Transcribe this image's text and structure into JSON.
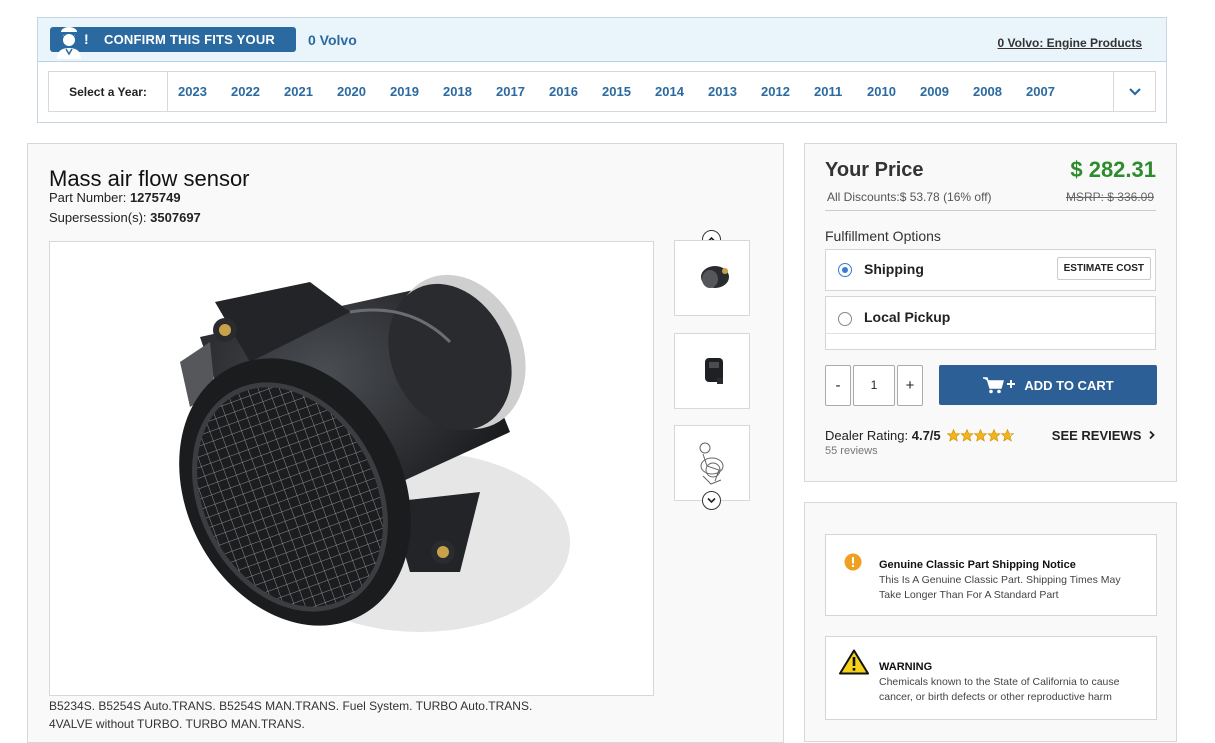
{
  "fitment": {
    "confirm_label": "CONFIRM THIS FITS YOUR",
    "vehicle": "0 Volvo",
    "engine_link": "0 Volvo: Engine Products",
    "year_label": "Select a Year:",
    "years": [
      "2023",
      "2022",
      "2021",
      "2020",
      "2019",
      "2018",
      "2017",
      "2016",
      "2015",
      "2014",
      "2013",
      "2012",
      "2011",
      "2010",
      "2009",
      "2008",
      "2007"
    ]
  },
  "product": {
    "title": "Mass air flow sensor",
    "part_number_label": "Part Number:",
    "part_number": "1275749",
    "supersession_label": "Supersession(s):",
    "supersession": "3507697",
    "description_line1": "B5234S. B5254S Auto.TRANS. B5254S MAN.TRANS. Fuel System. TURBO Auto.TRANS.",
    "description_line2": "4VALVE without TURBO. TURBO MAN.TRANS."
  },
  "pricing": {
    "your_price_label": "Your Price",
    "price": "$ 282.31",
    "discounts": "All Discounts:$ 53.78 (16% off)",
    "msrp": "MSRP: $ 336.09",
    "fulfillment_label": "Fulfillment Options",
    "shipping_label": "Shipping",
    "estimate_label": "ESTIMATE COST",
    "pickup_label": "Local Pickup",
    "qty_minus": "-",
    "qty_value": "1",
    "qty_plus": "+",
    "add_to_cart": "ADD TO CART",
    "dealer_rating_label": "Dealer Rating:",
    "dealer_rating": "4.7/5",
    "rating_value": 4.7,
    "reviews_count": "55 reviews",
    "see_reviews": "SEE REVIEWS"
  },
  "notices": {
    "shipping_title": "Genuine Classic Part Shipping Notice",
    "shipping_body": "This Is A Genuine Classic Part. Shipping Times May Take Longer Than For A Standard Part",
    "warning_title": "WARNING",
    "warning_body": "Chemicals known to the State of California to cause cancer, or birth defects or other reproductive harm"
  },
  "colors": {
    "accent_blue": "#2b6aa1",
    "price_green": "#2e8b2e",
    "cart_blue": "#2b5f96",
    "notice_orange": "#f0a020",
    "star_gold": "#f3b31a"
  }
}
